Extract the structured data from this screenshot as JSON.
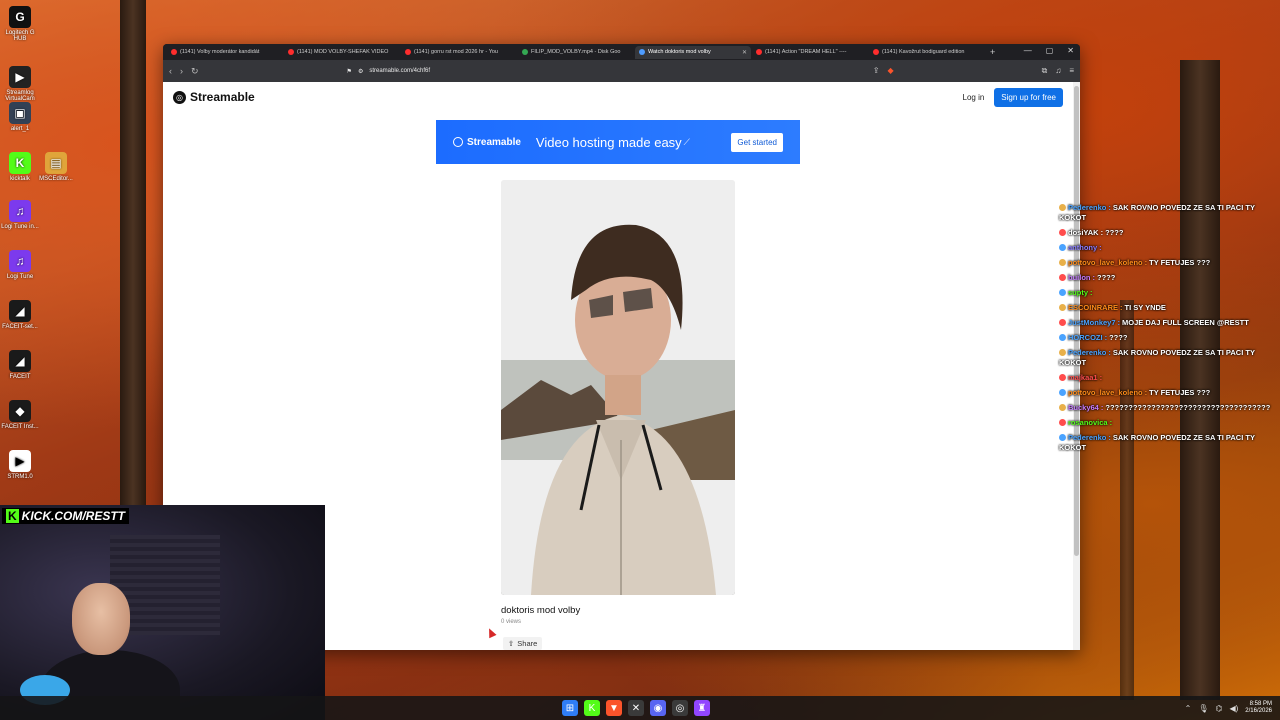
{
  "desktop": {
    "icons": [
      {
        "label": "Logitech G HUB",
        "color": "#111111",
        "glyph": "G"
      },
      {
        "label": "Streamlog VirtualCam",
        "color": "#222222",
        "glyph": "▶"
      },
      {
        "label": "alert_1",
        "color": "#334155",
        "glyph": "▣"
      },
      {
        "label": "kicktalk",
        "color": "#53fc18",
        "glyph": "K"
      },
      {
        "label": "MSCEditor...",
        "color": "#e0a43a",
        "glyph": "▤"
      },
      {
        "label": "Logi Tune in...",
        "color": "#7c3aed",
        "glyph": "♫"
      },
      {
        "label": "Logi Tune",
        "color": "#7c3aed",
        "glyph": "♫"
      },
      {
        "label": "FACEIT-set...",
        "color": "#1a1a1a",
        "glyph": "◢"
      },
      {
        "label": "FACEIT",
        "color": "#1a1a1a",
        "glyph": "◢"
      },
      {
        "label": "FACEIT Inst...",
        "color": "#1a1a1a",
        "glyph": "◆"
      },
      {
        "label": "STRM1.0",
        "color": "#ffffff",
        "glyph": "▶"
      }
    ]
  },
  "browser": {
    "tabs": [
      {
        "title": "(1141) Volby moderátor kandidát",
        "fav_color": "#ff2d2d",
        "active": false
      },
      {
        "title": "(1141) MOD VOLBY-SHEFAK VIDEO",
        "fav_color": "#ff2d2d",
        "active": false
      },
      {
        "title": "(1141) gorru rst mod 2026 hr - You",
        "fav_color": "#ff2d2d",
        "active": false
      },
      {
        "title": "FILIP_MOD_VOLBY.mp4 - Disk Goo",
        "fav_color": "#34a853",
        "active": false
      },
      {
        "title": "Watch doktoris mod volby",
        "fav_color": "#4e9cff",
        "active": true
      },
      {
        "title": "(1141) Action \"DREAM HELL\" ----",
        "fav_color": "#ff2d2d",
        "active": false
      },
      {
        "title": "(1141) Kavožrut bodiguard edition",
        "fav_color": "#ff2d2d",
        "active": false
      }
    ],
    "new_tab": "+",
    "url": "streamable.com/4chf6f"
  },
  "streamable": {
    "logo_text": "Streamable",
    "login": "Log in",
    "signup": "Sign up for free",
    "banner": {
      "logo": "Streamable",
      "tagline": "Video hosting made easy",
      "cta": "Get started"
    },
    "video": {
      "title": "doktoris mod volby",
      "views": "0 views",
      "share": "Share"
    }
  },
  "chat": [
    {
      "user": "Pederenko",
      "msg": "SAK ROVNO POVEDZ ZE SA TI PACI TY KOKOT",
      "color": "#4aa3ff"
    },
    {
      "user": "dosiYAK",
      "msg": "????",
      "color": "#ffffff"
    },
    {
      "user": "anthony",
      "msg": "",
      "color": "#8a7cff"
    },
    {
      "user": "pottovo_lave_koleno",
      "msg": "TY FETUJES ???",
      "color": "#ff8c1a"
    },
    {
      "user": "builon",
      "msg": "????",
      "color": "#c77dff"
    },
    {
      "user": "supty",
      "msg": "",
      "color": "#53fc18"
    },
    {
      "user": "ESCOINRARE",
      "msg": "TI SY YNDE",
      "color": "#ff8c1a"
    },
    {
      "user": "JustMonkey7",
      "msg": "MOJE DAJ FULL SCREEN @RESTT",
      "color": "#4aa3ff"
    },
    {
      "user": "HORCOZI",
      "msg": "????",
      "color": "#4aa3ff"
    },
    {
      "user": "Pederenko",
      "msg": "SAK ROVNO POVEDZ ZE SA TI PACI TY KOKOT",
      "color": "#4aa3ff"
    },
    {
      "user": "majkaa1",
      "msg": "",
      "color": "#ff4d4d"
    },
    {
      "user": "pottovo_lave_koleno",
      "msg": "TY FETUJES ???",
      "color": "#ff8c1a"
    },
    {
      "user": "Bucky64",
      "msg": "????????????????????????????????????",
      "color": "#c77dff"
    },
    {
      "user": "rosanovica",
      "msg": "",
      "color": "#53fc18"
    },
    {
      "user": "Pederenko",
      "msg": "SAK ROVNO POVEDZ ZE SA TI PACI TY KOKOT",
      "color": "#4aa3ff"
    }
  ],
  "webcam": {
    "brand_k": "K",
    "label": "KICK.COM/RESTT"
  },
  "taskbar": {
    "apps": [
      {
        "name": "windows-start",
        "glyph": "⊞",
        "color": "#2f7df6"
      },
      {
        "name": "kick",
        "glyph": "K",
        "color": "#53fc18"
      },
      {
        "name": "brave",
        "glyph": "▼",
        "color": "#fb542b"
      },
      {
        "name": "xbox",
        "glyph": "✕",
        "color": "#3a3a3a"
      },
      {
        "name": "discord",
        "glyph": "◉",
        "color": "#5865f2"
      },
      {
        "name": "obs",
        "glyph": "◎",
        "color": "#3a3a3a"
      },
      {
        "name": "twitch-app",
        "glyph": "♜",
        "color": "#9146ff"
      }
    ],
    "time": "8:58 PM",
    "date": "2/16/2026"
  }
}
